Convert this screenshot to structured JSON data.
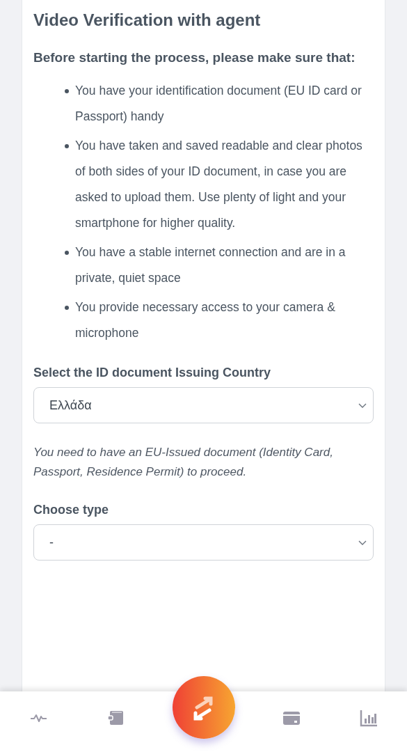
{
  "card": {
    "title": "Video Verification with agent",
    "intro": "Before starting the process, please make sure that:",
    "requirements": [
      "You have your identification document (EU ID card or Passport) handy",
      "You have taken and saved readable and clear photos of both sides of your ID document, in case you are asked to upload them. Use plenty of light and your smartphone for higher quality.",
      "You have a stable internet connection and are in a private, quiet space",
      "You provide necessary access to your camera & microphone"
    ],
    "fields": [
      {
        "label": "Select the ID document Issuing Country",
        "value": "Ελλάδα",
        "note": "You need to have an EU-Issued document (Identity Card, Passport, Residence Permit) to proceed."
      },
      {
        "label": "Choose type",
        "value": "-"
      }
    ]
  },
  "nav": [
    {
      "kind": "activity"
    },
    {
      "kind": "wallet"
    },
    {
      "kind": "exchange"
    },
    {
      "kind": "card"
    },
    {
      "kind": "chart"
    }
  ]
}
